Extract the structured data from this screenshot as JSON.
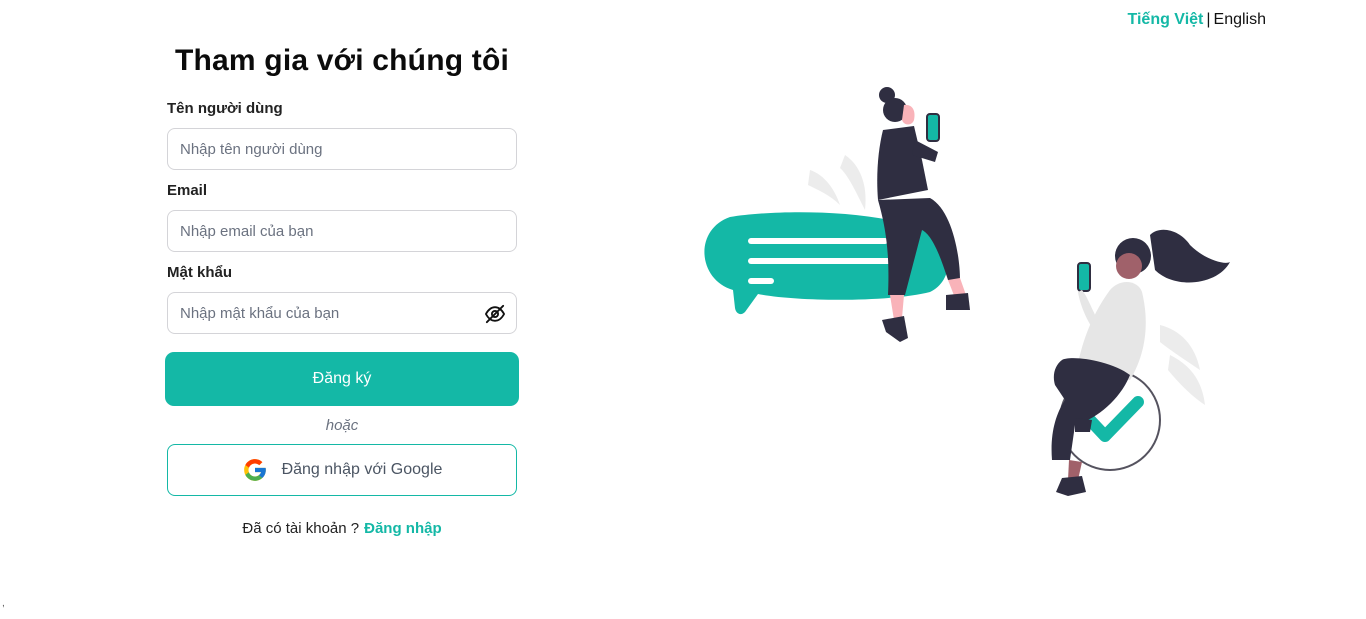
{
  "language": {
    "vietnamese": "Tiếng Việt",
    "separator": "|",
    "english": "English",
    "active_color": "#14b8a6"
  },
  "form": {
    "title": "Tham gia với chúng tôi",
    "username": {
      "label": "Tên người dùng",
      "placeholder": "Nhập tên người dùng",
      "value": ""
    },
    "email": {
      "label": "Email",
      "placeholder": "Nhập email của bạn",
      "value": ""
    },
    "password": {
      "label": "Mật khẩu",
      "placeholder": "Nhập mật khẩu của bạn",
      "value": "",
      "visibility_icon": "eye-off-icon"
    },
    "submit_label": "Đăng ký",
    "or_text": "hoặc",
    "google_label": "Đăng nhập với Google",
    "google_icon": "google-icon",
    "have_account_text": "Đã có tài khoản ?",
    "signin_link": "Đăng nhập"
  },
  "colors": {
    "accent": "#14b8a6",
    "text": "#111111",
    "border": "#d4d4d8"
  },
  "stray_mark": ","
}
